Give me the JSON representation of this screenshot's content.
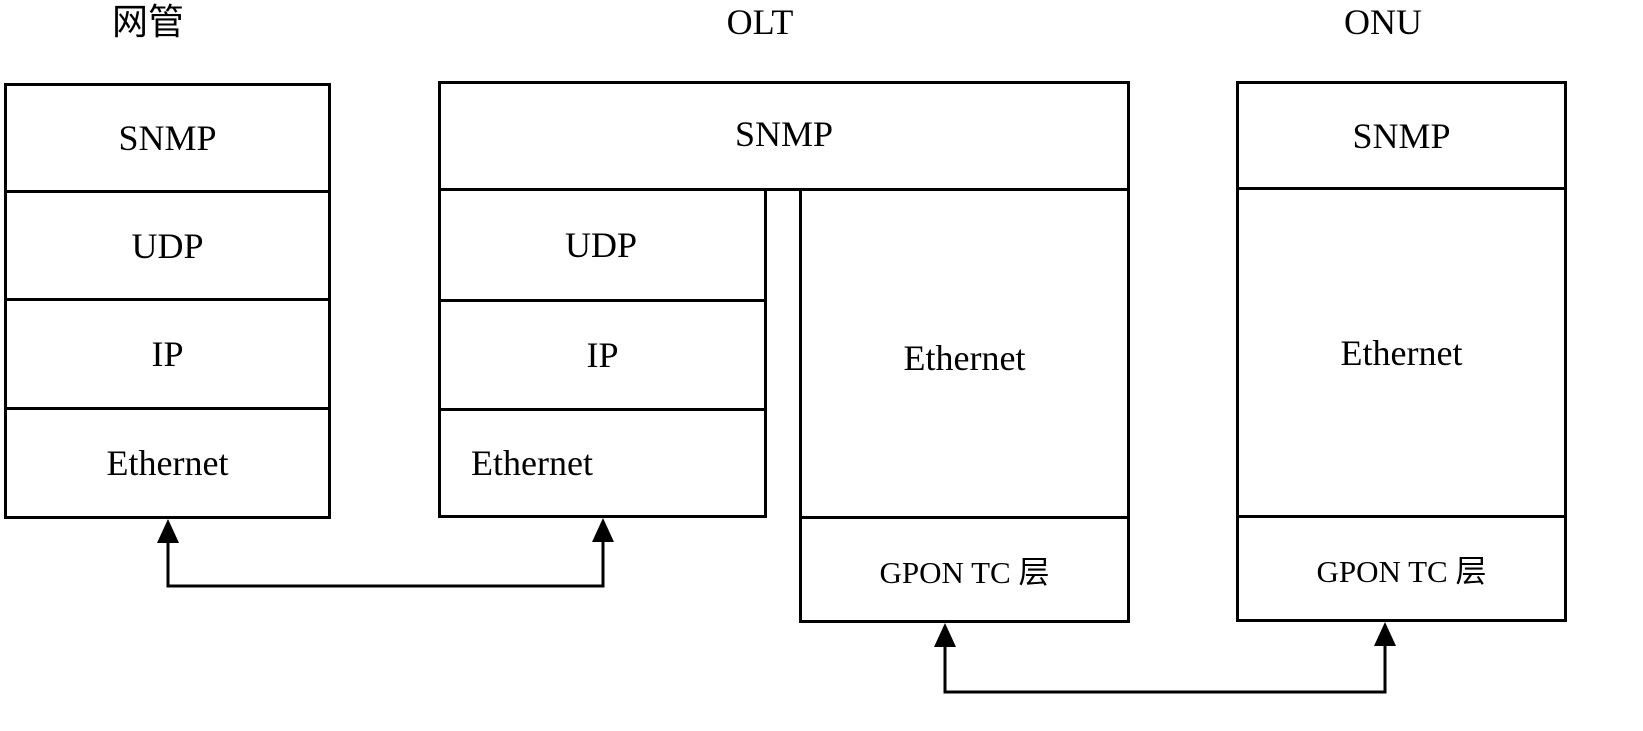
{
  "nodes": {
    "nms": {
      "title": "网管",
      "layers": [
        "SNMP",
        "UDP",
        "IP",
        "Ethernet"
      ]
    },
    "olt": {
      "title": "OLT",
      "top_layer": "SNMP",
      "left_stack": [
        "UDP",
        "IP",
        "Ethernet"
      ],
      "right_stack": [
        "Ethernet",
        "GPON TC 层"
      ]
    },
    "onu": {
      "title": "ONU",
      "layers": [
        "SNMP",
        "Ethernet",
        "GPON TC 层"
      ]
    }
  },
  "links": [
    {
      "from": "网管 Ethernet",
      "to": "OLT Ethernet",
      "direction": "bidirectional"
    },
    {
      "from": "OLT GPON TC 层",
      "to": "ONU GPON TC 层",
      "direction": "bidirectional"
    }
  ]
}
